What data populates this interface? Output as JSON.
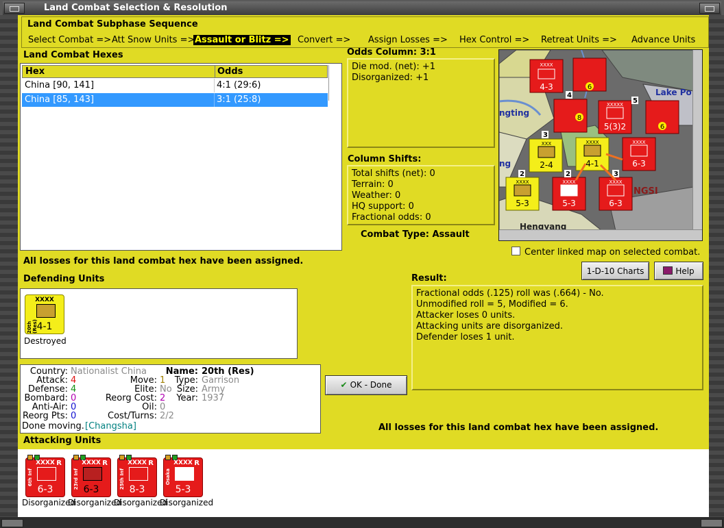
{
  "window": {
    "title": "Land Combat Selection & Resolution"
  },
  "subphase": {
    "title": "Land Combat Subphase Sequence",
    "steps": [
      "Select Combat =>",
      "Att Snow Units =>",
      "Assault or Blitz =>",
      "Convert =>",
      "Assign Losses =>",
      "Hex Control =>",
      "Retreat Units =>",
      "Advance Units"
    ],
    "active_index": 2
  },
  "combat_hexes": {
    "title": "Land Combat Hexes",
    "columns": [
      "Hex",
      "Odds"
    ],
    "rows": [
      {
        "hex": "China [90, 141]",
        "odds": "4:1 (29:6)"
      },
      {
        "hex": "China [85, 143]",
        "odds": "3:1 (25:8)"
      }
    ],
    "selected_index": 1
  },
  "odds_column": {
    "title": "Odds Column: 3:1",
    "lines": [
      "Die mod. (net): +1",
      "Disorganized: +1"
    ]
  },
  "column_shifts": {
    "title": "Column Shifts:",
    "lines": [
      "Total shifts (net): 0",
      "Terrain: 0",
      "Weather: 0",
      "HQ support: 0",
      "Fractional odds: 0"
    ]
  },
  "combat_type": "Combat Type:  Assault",
  "map": {
    "labels": [
      "Lake Po",
      "ngting",
      "NGSI",
      "ng",
      "Hengyang"
    ],
    "units": [
      {
        "size": "XXXX",
        "strength": "4-3",
        "color": "red"
      },
      {
        "size": "",
        "strength": "6",
        "color": "red"
      },
      {
        "size": "",
        "strength": "8",
        "color": "red"
      },
      {
        "size": "XXXXX",
        "strength": "5(3)2",
        "color": "red"
      },
      {
        "size": "",
        "strength": "6",
        "color": "red"
      },
      {
        "size": "XXX",
        "strength": "2-4",
        "color": "yellow"
      },
      {
        "size": "XXXX",
        "strength": "4-1",
        "color": "yellow"
      },
      {
        "size": "XXXX",
        "strength": "6-3",
        "color": "red"
      },
      {
        "size": "XXXX",
        "strength": "5-3",
        "color": "yellow"
      },
      {
        "size": "XXXX",
        "strength": "5-3",
        "color": "red"
      },
      {
        "size": "XXXX",
        "strength": "6-3",
        "color": "red"
      }
    ],
    "stack_numbers": [
      "4",
      "5",
      "3",
      "2",
      "2",
      "3"
    ]
  },
  "center_map_label": "Center linked map on selected combat.",
  "losses_msg_top": "All losses for this land combat hex have been assigned.",
  "losses_msg_bottom": "All losses for this land combat hex have been assigned.",
  "buttons": {
    "charts": "1-D-10 Charts",
    "help": "Help",
    "ok": "OK - Done"
  },
  "defending": {
    "title": "Defending Units",
    "units": [
      {
        "size": "XXXX",
        "name": "20th (Res)",
        "strength": "4-1",
        "status": "Destroyed"
      }
    ]
  },
  "result": {
    "title": "Result:",
    "lines": [
      "Fractional odds (.125) roll was (.664)  - No.",
      "Unmodified roll = 5, Modified = 6.",
      "Attacker loses 0 units.",
      "Attacking units are disorganized.",
      "Defender loses 1 unit."
    ]
  },
  "unit_info": {
    "country_label": "Country:",
    "country": "Nationalist China",
    "attack_label": "Attack:",
    "attack": "4",
    "defense_label": "Defense:",
    "defense": "4",
    "bombard_label": "Bombard:",
    "bombard": "0",
    "antiair_label": "Anti-Air:",
    "antiair": "0",
    "reorg_pts_label": "Reorg Pts:",
    "reorg_pts": "0",
    "move_label": "Move:",
    "move": "1",
    "elite_label": "Elite:",
    "elite": "No",
    "reorg_cost_label": "Reorg Cost:",
    "reorg_cost": "2",
    "oil_label": "Oil:",
    "oil": "0",
    "cost_turns_label": "Cost/Turns:",
    "cost_turns": "2/2",
    "name_label": "Name:",
    "name": "20th (Res)",
    "type_label": "Type:",
    "type": "Garrison",
    "size_label": "Size:",
    "size": "Army",
    "year_label": "Year:",
    "year": "1937",
    "done_moving_label": "Done moving.",
    "done_moving": "[Changsha]"
  },
  "attacking": {
    "title": "Attacking Units",
    "units": [
      {
        "size": "XXXX",
        "name": "6th Inf",
        "strength": "6-3",
        "status": "Disorganized",
        "flag": "R"
      },
      {
        "size": "XXXX",
        "name": "23rd Inf",
        "strength": "6-3",
        "status": "Disorganized",
        "flag": "R"
      },
      {
        "size": "XXXX",
        "name": "25th Inf",
        "strength": "8-3",
        "status": "Disorganized",
        "flag": "R"
      },
      {
        "size": "XXXX",
        "name": "Osaka",
        "strength": "5-3",
        "status": "Disorganized",
        "flag": "R"
      }
    ]
  },
  "colors": {
    "panel": "#e0db24",
    "selection": "#3399ff",
    "axis_red": "#e51b1b",
    "allied_yellow": "#f4ee1a"
  }
}
